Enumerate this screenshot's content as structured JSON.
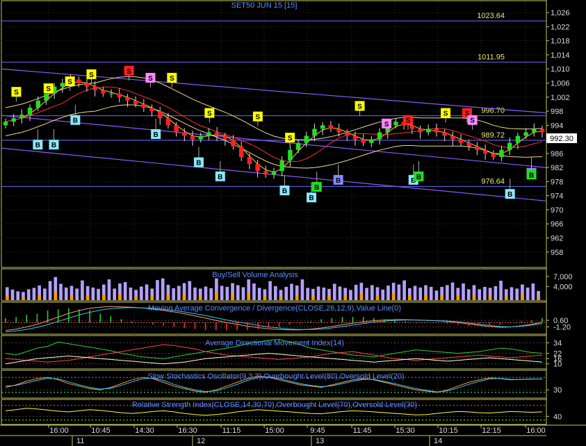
{
  "chart_data": [
    {
      "type": "candlestick",
      "title": "SET50 JUN 15   [15]",
      "last_price": "992.30",
      "ylim": [
        955,
        1028
      ],
      "yticks": [
        "1,026",
        "1,022",
        "1,018",
        "1,014",
        "1,010",
        "1,006",
        "1,002",
        "998",
        "994",
        "990",
        "986",
        "982",
        "978",
        "974",
        "970",
        "966",
        "962",
        "958"
      ],
      "ytick_values": [
        1026,
        1022,
        1018,
        1014,
        1010,
        1006,
        1002,
        998,
        994,
        990,
        986,
        982,
        978,
        974,
        970,
        966,
        962,
        958
      ],
      "levels": [
        {
          "label": "1023.64",
          "value": 1023.64
        },
        {
          "label": "1011.95",
          "value": 1011.95
        },
        {
          "label": "996.70",
          "value": 996.7
        },
        {
          "label": "989.72",
          "value": 989.72
        },
        {
          "label": "976.64",
          "value": 976.64
        }
      ],
      "close_series": [
        995,
        996,
        997,
        999,
        1001,
        1003,
        1005,
        1006,
        1007,
        1006,
        1005,
        1004,
        1003,
        1003,
        1002,
        1001,
        1000,
        999,
        998,
        996,
        994,
        992,
        991,
        990,
        991,
        992,
        991,
        990,
        988,
        985,
        983,
        981,
        980,
        981,
        984,
        987,
        989,
        991,
        993,
        994,
        993,
        992,
        991,
        990,
        989,
        990,
        992,
        994,
        995,
        994,
        993,
        992,
        993,
        992,
        991,
        990,
        989,
        988,
        987,
        986,
        985,
        987,
        989,
        991,
        992,
        993,
        992
      ],
      "signals": [
        {
          "t": "S",
          "x": 2,
          "v": 1003.5,
          "c": "yellow"
        },
        {
          "t": "S",
          "x": 8,
          "v": 1004.5,
          "c": "yellow"
        },
        {
          "t": "S",
          "x": 12,
          "v": 1006.5,
          "c": "yellow"
        },
        {
          "t": "S",
          "x": 16,
          "v": 1008.5,
          "c": "yellow"
        },
        {
          "t": "S",
          "x": 23,
          "v": 1009.5,
          "c": "red"
        },
        {
          "t": "S",
          "x": 27,
          "v": 1007.5,
          "c": "pink"
        },
        {
          "t": "S",
          "x": 31,
          "v": 1007.5,
          "c": "yellow"
        },
        {
          "t": "S",
          "x": 38,
          "v": 997.5,
          "c": "yellow"
        },
        {
          "t": "S",
          "x": 47,
          "v": 996.5,
          "c": "yellow"
        },
        {
          "t": "S",
          "x": 53,
          "v": 990.5,
          "c": "yellow"
        },
        {
          "t": "S",
          "x": 66,
          "v": 999.5,
          "c": "yellow"
        },
        {
          "t": "S",
          "x": 71,
          "v": 994.5,
          "c": "pink"
        },
        {
          "t": "S",
          "x": 75,
          "v": 995.5,
          "c": "red"
        },
        {
          "t": "S",
          "x": 82,
          "v": 997.5,
          "c": "yellow"
        },
        {
          "t": "S",
          "x": 86,
          "v": 997.5,
          "c": "red"
        },
        {
          "t": "S",
          "x": 87,
          "v": 995.5,
          "c": "pink"
        },
        {
          "t": "B",
          "x": 13,
          "v": 995.5,
          "c": "cyan"
        },
        {
          "t": "B",
          "x": 6,
          "v": 988.5,
          "c": "cyan"
        },
        {
          "t": "B",
          "x": 9,
          "v": 988.5,
          "c": "cyan"
        },
        {
          "t": "B",
          "x": 28,
          "v": 991.5,
          "c": "cyan"
        },
        {
          "t": "B",
          "x": 36,
          "v": 983.5,
          "c": "cyan"
        },
        {
          "t": "B",
          "x": 40,
          "v": 979.5,
          "c": "cyan"
        },
        {
          "t": "B",
          "x": 52,
          "v": 975.5,
          "c": "cyan"
        },
        {
          "t": "B",
          "x": 57,
          "v": 973.5,
          "c": "cyan"
        },
        {
          "t": "B",
          "x": 58,
          "v": 976.5,
          "c": "green"
        },
        {
          "t": "B",
          "x": 62,
          "v": 978.5,
          "c": "violet"
        },
        {
          "t": "B",
          "x": 76,
          "v": 978.5,
          "c": "cyan"
        },
        {
          "t": "B",
          "x": 77,
          "v": 979.5,
          "c": "green"
        },
        {
          "t": "B",
          "x": 94,
          "v": 974.5,
          "c": "cyan"
        },
        {
          "t": "B",
          "x": 98,
          "v": 980.5,
          "c": "violet"
        },
        {
          "t": "B",
          "x": 98,
          "v": 980.0,
          "c": "green"
        }
      ]
    },
    {
      "type": "bar",
      "title": "Buy/Sell Volume Analysis",
      "yticks": [
        "7,000",
        "4,000"
      ],
      "ytick_values": [
        7000,
        4000
      ],
      "values": [
        3800,
        3100,
        2600,
        2400,
        3200,
        3600,
        4300,
        3400,
        5600,
        6800,
        4800,
        3700,
        4200,
        3400,
        5800,
        4100,
        3700,
        3300,
        4600,
        6100,
        3400,
        4900,
        5300,
        3700,
        3000,
        4000,
        4600,
        3400,
        5900,
        6400,
        4500,
        3500,
        4200,
        5000,
        5600,
        3700,
        3400,
        4000,
        3500,
        6400,
        4200,
        3900,
        5000,
        4400,
        3800,
        6100,
        4900,
        3600,
        3200,
        5600,
        4100,
        3000,
        3900,
        4800,
        4300,
        6100,
        3600,
        3300,
        4000,
        3700,
        3300,
        4800,
        4000,
        3600,
        3000,
        4500,
        5100,
        3600,
        4400,
        3800,
        3100,
        4300,
        5100,
        4600,
        5800,
        3500,
        4200,
        3700,
        4400,
        3900,
        2800,
        3900,
        4400,
        5200,
        3600,
        4900,
        3200,
        4400,
        3200,
        3900,
        3600,
        4100,
        5700,
        3200,
        3800,
        3400,
        4600,
        3700,
        4900,
        2700
      ]
    },
    {
      "type": "line",
      "title": "Moving Average Convergence / Divergence(CLOSE,26,12,9),Value Line(0)",
      "yticks": [
        "0.60",
        "-1.20"
      ],
      "ytick_values": [
        0.6,
        -1.2
      ],
      "series": [
        {
          "values": [
            -2.2,
            -1.8,
            -1.2,
            -0.5,
            0.5,
            1.5,
            2.5,
            3.3,
            3.9,
            4.2,
            4.4,
            4.3,
            4.2,
            4.0,
            3.7,
            3.3,
            2.9,
            2.4,
            1.8,
            1.2,
            0.6,
            0.0,
            -0.5,
            -1.0,
            -1.4,
            -1.7,
            -1.9,
            -2.0,
            -2.0,
            -1.8,
            -1.5,
            -1.1,
            -0.6,
            -0.2,
            0.2,
            0.5,
            0.7,
            0.8,
            0.8,
            0.7,
            0.6,
            0.5,
            0.3,
            0.0,
            -0.4,
            -0.8,
            -1.1,
            -1.3,
            -1.2,
            -0.9,
            -0.5,
            0.1
          ]
        },
        {
          "values": [
            -2.6,
            -2.3,
            -1.9,
            -1.3,
            -0.6,
            0.3,
            1.2,
            2.1,
            2.8,
            3.4,
            3.8,
            4.0,
            4.1,
            4.0,
            3.9,
            3.6,
            3.3,
            2.9,
            2.4,
            1.9,
            1.3,
            0.7,
            0.2,
            -0.3,
            -0.8,
            -1.2,
            -1.5,
            -1.8,
            -1.9,
            -1.9,
            -1.8,
            -1.5,
            -1.1,
            -0.7,
            -0.3,
            0.1,
            0.4,
            0.6,
            0.7,
            0.7,
            0.6,
            0.5,
            0.4,
            0.2,
            -0.1,
            -0.5,
            -0.8,
            -1.1,
            -1.2,
            -1.0,
            -0.7,
            -0.3
          ]
        }
      ]
    },
    {
      "type": "line",
      "title": "Average Directional Movement Index(14)",
      "yticks": [
        "34",
        "22",
        "16",
        "10"
      ],
      "ytick_values": [
        34,
        22,
        16,
        10
      ],
      "series": [
        {
          "values": [
            22,
            20,
            24,
            28,
            30,
            35,
            33,
            31,
            29,
            27,
            25,
            22,
            20,
            18,
            17,
            16,
            18,
            20,
            22,
            24,
            26,
            28,
            30,
            33,
            35,
            37,
            38,
            35,
            32,
            28,
            26,
            24,
            22,
            20,
            19,
            18,
            20,
            22,
            24,
            26,
            25,
            24,
            23,
            22,
            23,
            24,
            26,
            28,
            27,
            25,
            23,
            22
          ]
        },
        {
          "values": [
            16,
            15,
            14,
            13,
            12,
            13,
            14,
            16,
            18,
            20,
            22,
            24,
            26,
            28,
            30,
            32,
            31,
            29,
            27,
            24,
            22,
            20,
            19,
            18,
            17,
            16,
            15,
            16,
            17,
            18,
            20,
            22,
            23,
            24,
            22,
            20,
            18,
            16,
            15,
            14,
            15,
            16,
            17,
            18,
            19,
            20,
            19,
            18,
            17,
            18,
            19,
            20
          ]
        },
        {
          "values": [
            10,
            12,
            14,
            16,
            17,
            18,
            19,
            18,
            17,
            16,
            15,
            14,
            13,
            12,
            11,
            10,
            11,
            12,
            14,
            16,
            17,
            18,
            19,
            20,
            21,
            22,
            21,
            20,
            19,
            18,
            17,
            16,
            15,
            14,
            13,
            12,
            13,
            14,
            15,
            16,
            15,
            14,
            13,
            14,
            15,
            16,
            17,
            16,
            15,
            14,
            13,
            12
          ]
        }
      ]
    },
    {
      "type": "line",
      "title": "Slow Stochastics Oscillator(9,3,3),Overbought Level(80),Oversold Level(20)",
      "yticks": [
        "30"
      ],
      "ytick_values": [
        30
      ],
      "series": [
        {
          "values": [
            40,
            50,
            65,
            75,
            80,
            70,
            55,
            45,
            35,
            30,
            40,
            55,
            70,
            80,
            75,
            60,
            45,
            35,
            25,
            20,
            30,
            45,
            60,
            75,
            85,
            80,
            70,
            60,
            50,
            45,
            40,
            50,
            60,
            70,
            75,
            70,
            60,
            50,
            40,
            30,
            25,
            20,
            30,
            45,
            60,
            70,
            78,
            75,
            70,
            72,
            74,
            73
          ]
        },
        {
          "values": [
            45,
            48,
            58,
            68,
            76,
            74,
            62,
            50,
            40,
            33,
            36,
            48,
            62,
            74,
            77,
            68,
            52,
            40,
            30,
            23,
            26,
            38,
            52,
            68,
            80,
            82,
            75,
            65,
            55,
            48,
            43,
            46,
            55,
            65,
            72,
            72,
            64,
            55,
            45,
            35,
            28,
            22,
            26,
            38,
            52,
            64,
            74,
            76,
            72,
            71,
            73,
            74
          ]
        }
      ]
    },
    {
      "type": "line",
      "title": "Relative Strength Index(CLOSE,14,30,70),Overbought Level(70),Oversold Level(30)",
      "yticks": [
        "40"
      ],
      "ytick_values": [
        40
      ],
      "series": [
        {
          "values": [
            55,
            58,
            62,
            60,
            57,
            54,
            52,
            55,
            58,
            56,
            53,
            50,
            48,
            50,
            53,
            55,
            52,
            48,
            45,
            43,
            45,
            48,
            52,
            55,
            58,
            56,
            54,
            52,
            50,
            48,
            47,
            50,
            53,
            55,
            54,
            52,
            50,
            48,
            46,
            44,
            45,
            48,
            51,
            53,
            52,
            50,
            49,
            51,
            53,
            52,
            51,
            52
          ]
        }
      ]
    },
    {
      "type": "time_axis",
      "time_labels": [
        "16:00",
        "10:45",
        "14:30",
        "16:30",
        "11:15",
        "15:00",
        "9:45",
        "11:45",
        "15:30",
        "10:15",
        "12:15",
        "16:00"
      ],
      "date_labels": [
        "11",
        "12",
        "13",
        "14"
      ]
    }
  ]
}
